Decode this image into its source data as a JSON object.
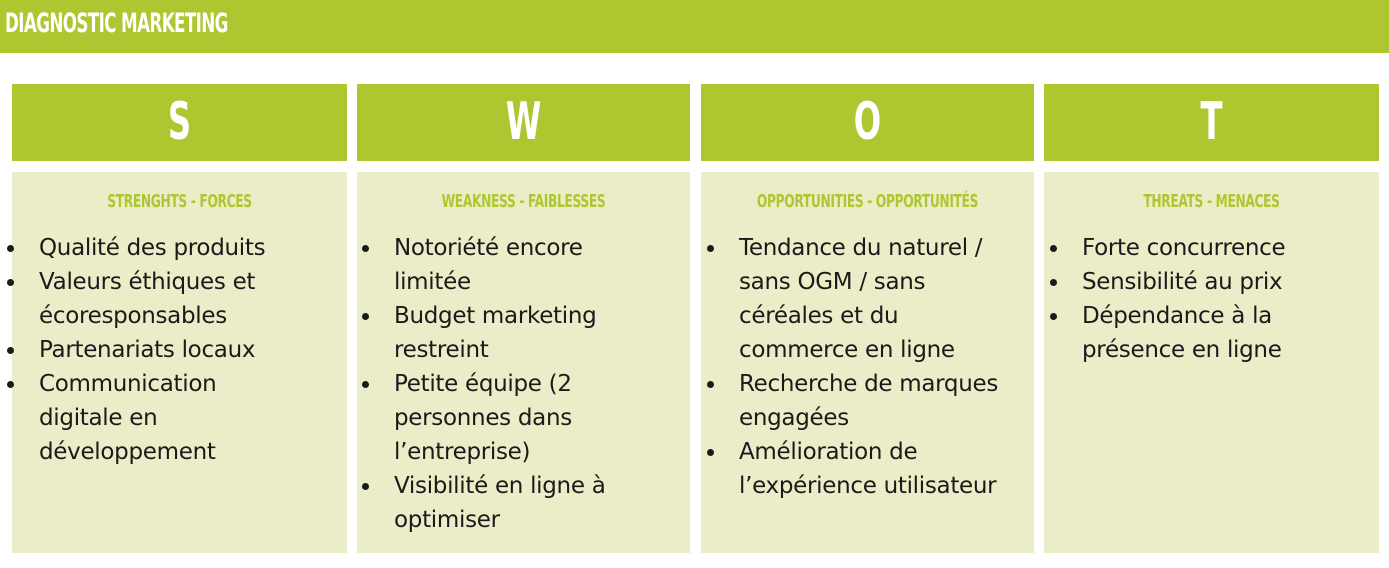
{
  "header": {
    "title": "DIAGNOSTIC MARKETING"
  },
  "colors": {
    "accent": "#aec62f",
    "panel": "#ebecc8",
    "text": "#1a1a1a"
  },
  "swot": [
    {
      "letter": "S",
      "heading": "STRENGHTS - FORCES",
      "items": [
        "Qualité des produits",
        "Valeurs éthiques et écoresponsables",
        "Partenariats locaux",
        "Communication digitale en développement"
      ]
    },
    {
      "letter": "W",
      "heading": "WEAKNESS - FAIBLESSES",
      "items": [
        "Notoriété encore limitée",
        "Budget marketing restreint",
        "Petite équipe (2 personnes dans l’entreprise)",
        "Visibilité en ligne à optimiser"
      ]
    },
    {
      "letter": "O",
      "heading": "OPPORTUNITIES - OPPORTUNITÉS",
      "items": [
        "Tendance du naturel / sans OGM / sans céréales et du commerce en ligne",
        "Recherche de marques engagées",
        "Amélioration de l’expérience utilisateur"
      ]
    },
    {
      "letter": "T",
      "heading": "THREATS - MENACES",
      "items": [
        "Forte concurrence",
        "Sensibilité au prix",
        "Dépendance à la présence en ligne"
      ]
    }
  ]
}
